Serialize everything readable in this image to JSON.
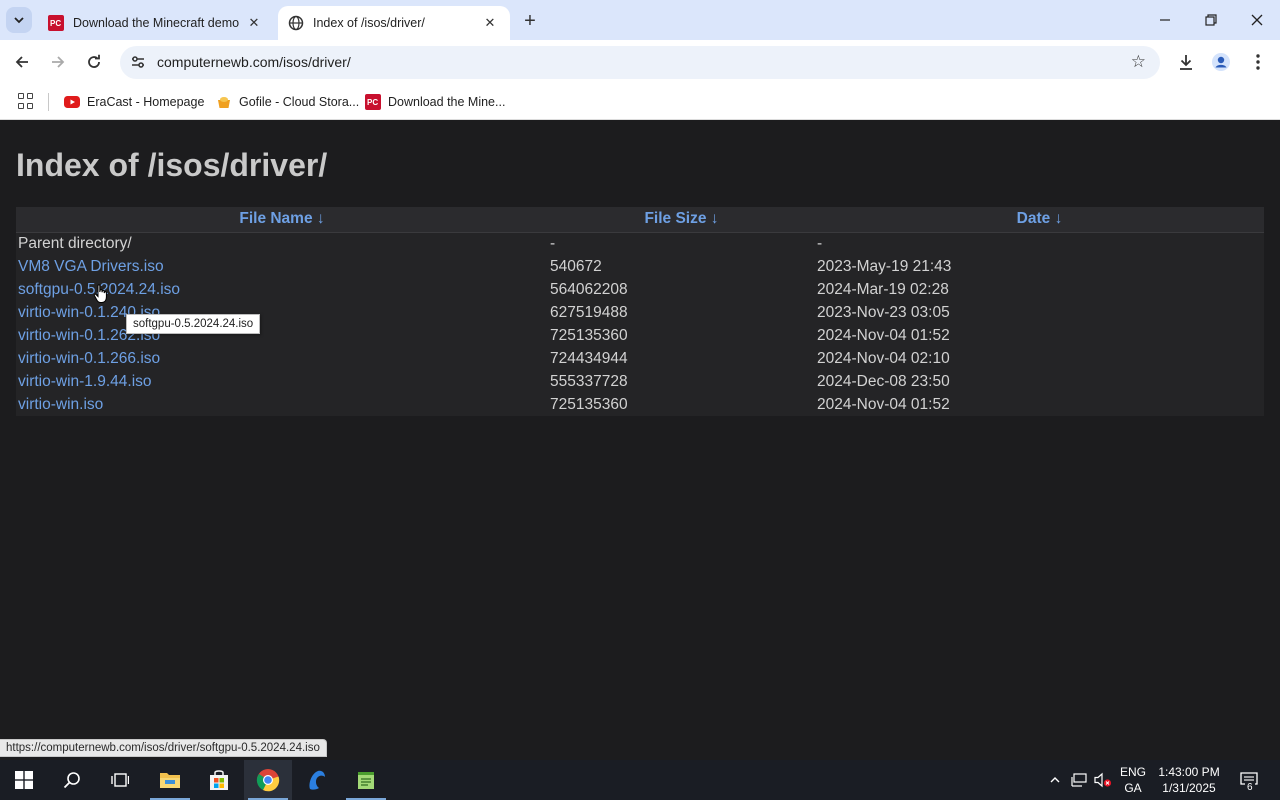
{
  "browser": {
    "tabs": [
      {
        "title": "Download the Minecraft demo",
        "favicon": "pcmag-icon"
      },
      {
        "title": "Index of /isos/driver/",
        "favicon": "globe-icon",
        "active": true
      }
    ],
    "address": "computernewb.com/isos/driver/",
    "bookmarks": [
      {
        "label": "EraCast - Homepage",
        "icon": "youtube-icon"
      },
      {
        "label": "Gofile - Cloud Stora...",
        "icon": "gofile-icon"
      },
      {
        "label": "Download the Mine...",
        "icon": "pcmag-icon"
      }
    ]
  },
  "page": {
    "heading": "Index of /isos/driver/",
    "columns": {
      "name": "File Name  ↓",
      "size": "File Size  ↓",
      "date": "Date  ↓"
    },
    "rows": [
      {
        "name": "Parent directory/",
        "size": "-",
        "date": "-"
      },
      {
        "name": "VM8 VGA Drivers.iso",
        "size": "540672",
        "date": "2023-May-19 21:43"
      },
      {
        "name": "softgpu-0.5.2024.24.iso",
        "size": "564062208",
        "date": "2024-Mar-19 02:28"
      },
      {
        "name": "virtio-win-0.1.240.iso",
        "size": "627519488",
        "date": "2023-Nov-23 03:05"
      },
      {
        "name": "virtio-win-0.1.262.iso",
        "size": "725135360",
        "date": "2024-Nov-04 01:52"
      },
      {
        "name": "virtio-win-0.1.266.iso",
        "size": "724434944",
        "date": "2024-Nov-04 02:10"
      },
      {
        "name": "virtio-win-1.9.44.iso",
        "size": "555337728",
        "date": "2024-Dec-08 23:50"
      },
      {
        "name": "virtio-win.iso",
        "size": "725135360",
        "date": "2024-Nov-04 01:52"
      }
    ],
    "tooltip": "softgpu-0.5.2024.24.iso",
    "status_url": "https://computernewb.com/isos/driver/softgpu-0.5.2024.24.iso"
  },
  "taskbar": {
    "apps": [
      "file-explorer-icon",
      "store-icon",
      "chrome-icon",
      "edge-legacy-icon",
      "notepad-icon"
    ],
    "lang": [
      "ENG",
      "GA"
    ],
    "time": "1:43:00 PM",
    "date": "1/31/2025",
    "notifications": "6"
  },
  "colors": {
    "link": "#6ea0e4",
    "page_bg": "#1c1c1e",
    "tabstrip_bg": "#dbe6fb",
    "taskbar_bg": "#1a1d24"
  }
}
